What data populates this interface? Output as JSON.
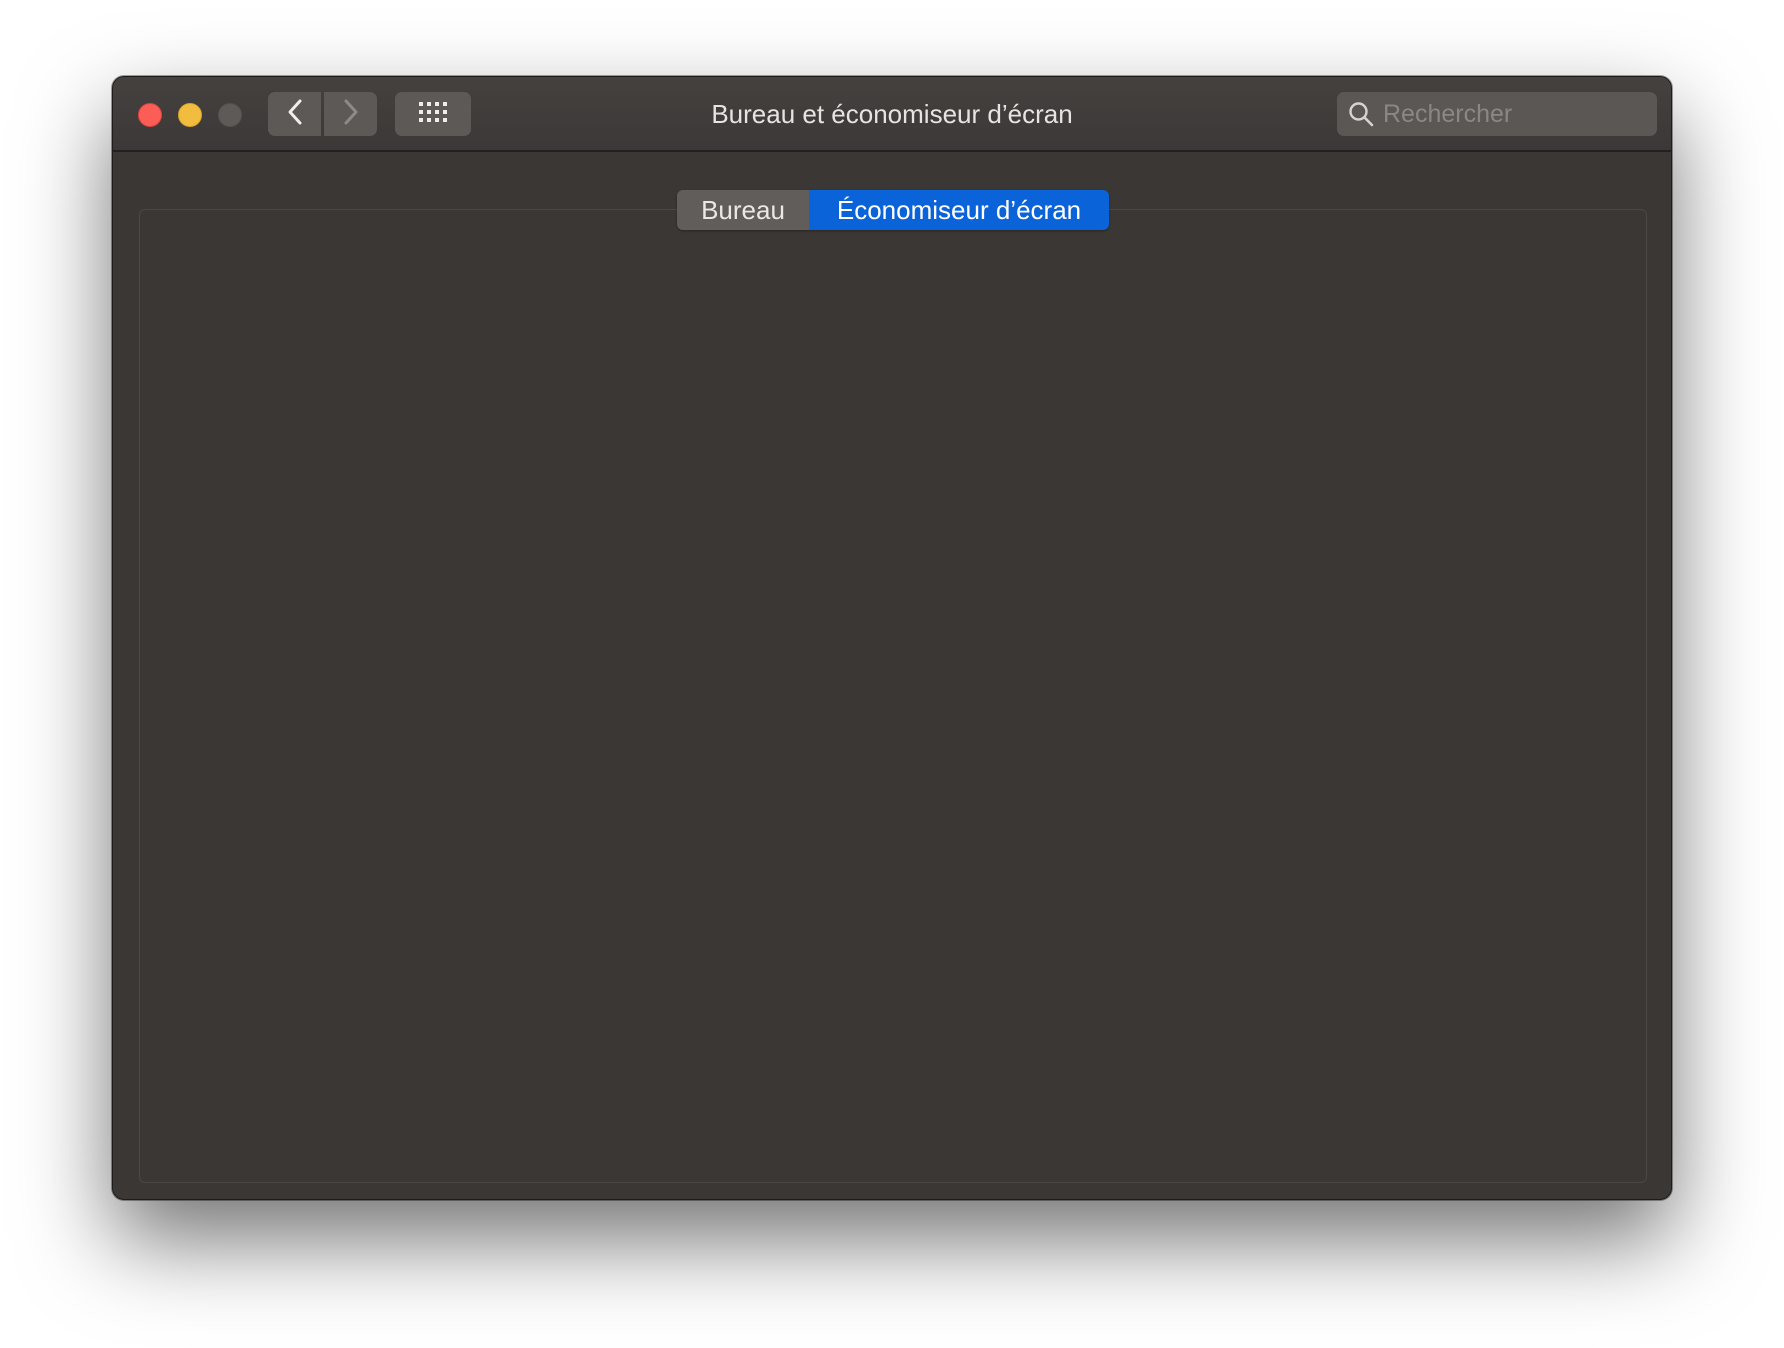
{
  "window": {
    "title": "Bureau et économiseur d’écran"
  },
  "toolbar": {
    "back_icon": "chevron-left-icon",
    "forward_icon": "chevron-right-icon",
    "show_all_icon": "grid-icon"
  },
  "search": {
    "placeholder": "Rechercher",
    "value": "",
    "icon": "search-icon"
  },
  "tabs": [
    {
      "label": "Bureau",
      "selected": false
    },
    {
      "label": "Économiseur d’écran",
      "selected": true
    }
  ],
  "colors": {
    "accent": "#0a63d8",
    "close": "#fd5d57",
    "minimize": "#f2bd3f",
    "zoom_disabled": "#5e5a58",
    "window_background": "#3b3735"
  }
}
